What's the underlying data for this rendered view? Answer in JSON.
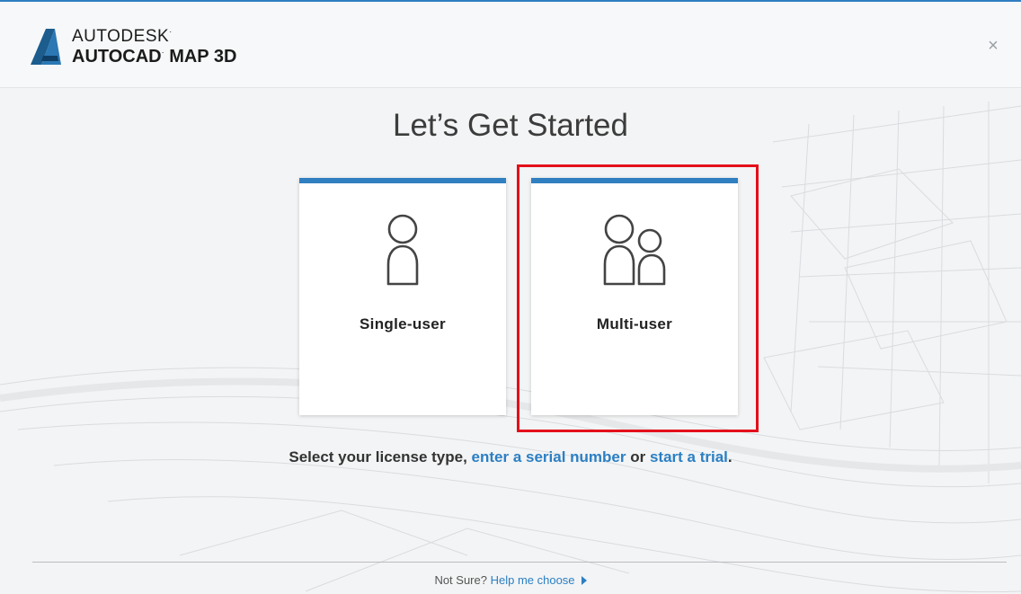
{
  "header": {
    "company": "AUTODESK",
    "company_mark": "·",
    "product": "AUTOCAD",
    "product_suffix": "MAP 3D",
    "close_glyph": "×",
    "logo_icon": "autodesk-a-logo-icon",
    "close_icon": "close-icon"
  },
  "main": {
    "title": "Let’s Get Started",
    "cards": [
      {
        "label": "Single-user",
        "icon": "single-user-icon"
      },
      {
        "label": "Multi-user",
        "icon": "multi-user-icon"
      }
    ],
    "prompt_lead": "Select your license type, ",
    "prompt_link_serial": "enter a serial number",
    "prompt_or": " or ",
    "prompt_link_trial": "start a trial",
    "prompt_end": "."
  },
  "footer": {
    "question": "Not Sure? ",
    "help_link": "Help me choose",
    "arrow_icon": "triangle-right-icon"
  },
  "colors": {
    "accent": "#2f7fc1",
    "link": "#2b7fc3",
    "highlight": "#e3101b"
  }
}
